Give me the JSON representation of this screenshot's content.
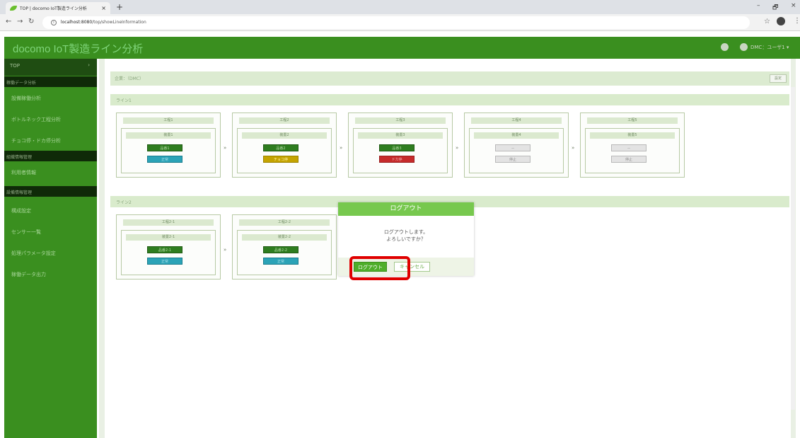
{
  "browser": {
    "tab_title": "TOP | docomo IoT製造ライン分析",
    "tab_close": "×",
    "new_tab": "+",
    "url_host": "localhost:8080",
    "url_path": "/top/showLineInformation",
    "window_controls": [
      "–",
      "🗗",
      "×"
    ]
  },
  "header": {
    "title": "docomo IoT製造ライン分析",
    "user_label": "DMC：ユーザ1 ▾"
  },
  "sidebar": {
    "top_label": "TOP",
    "top_arrow": "›",
    "sections": [
      {
        "label": "稼働データ分析",
        "items": [
          "設備稼働分析",
          "ボトルネック工程分析",
          "チョコ停・ドカ停分析"
        ]
      },
      {
        "label": "組織情報管理",
        "items": [
          "利用者情報"
        ]
      },
      {
        "label": "設備情報管理",
        "items": [
          "構成設定",
          "センサー一覧",
          "処理パラメータ設定",
          "稼働データ出力"
        ]
      }
    ]
  },
  "main": {
    "company_label": "企業：（DMC）",
    "setting_button": "設定",
    "lines": [
      {
        "label": "ライン1",
        "processes": [
          {
            "process": "工程1",
            "equipment": "装置1",
            "name_chip": "品番1",
            "status_chip": "正常",
            "status_type": "ok",
            "name_type": "run"
          },
          {
            "process": "工程2",
            "equipment": "装置2",
            "name_chip": "品番2",
            "status_chip": "チョコ停",
            "status_type": "choco",
            "name_type": "run"
          },
          {
            "process": "工程3",
            "equipment": "装置3",
            "name_chip": "品番3",
            "status_chip": "ドカ停",
            "status_type": "stop-red",
            "name_type": "run"
          },
          {
            "process": "工程4",
            "equipment": "装置4",
            "name_chip": "－",
            "status_chip": "停止",
            "status_type": "gray",
            "name_type": "gray"
          },
          {
            "process": "工程5",
            "equipment": "装置5",
            "name_chip": "－",
            "status_chip": "停止",
            "status_type": "gray",
            "name_type": "gray"
          }
        ]
      },
      {
        "label": "ライン2",
        "processes": [
          {
            "process": "工程2-1",
            "equipment": "装置2-1",
            "name_chip": "品番2-1",
            "status_chip": "正常",
            "status_type": "ok",
            "name_type": "run"
          },
          {
            "process": "工程2-2",
            "equipment": "装置2-2",
            "name_chip": "品番2-2",
            "status_chip": "正常",
            "status_type": "ok",
            "name_type": "run"
          }
        ]
      }
    ],
    "chevron": "»"
  },
  "modal": {
    "title": "ログアウト",
    "message_line1": "ログアウトします。",
    "message_line2": "よろしいですか？",
    "confirm_label": "ログアウト",
    "cancel_label": "キャンセル"
  }
}
